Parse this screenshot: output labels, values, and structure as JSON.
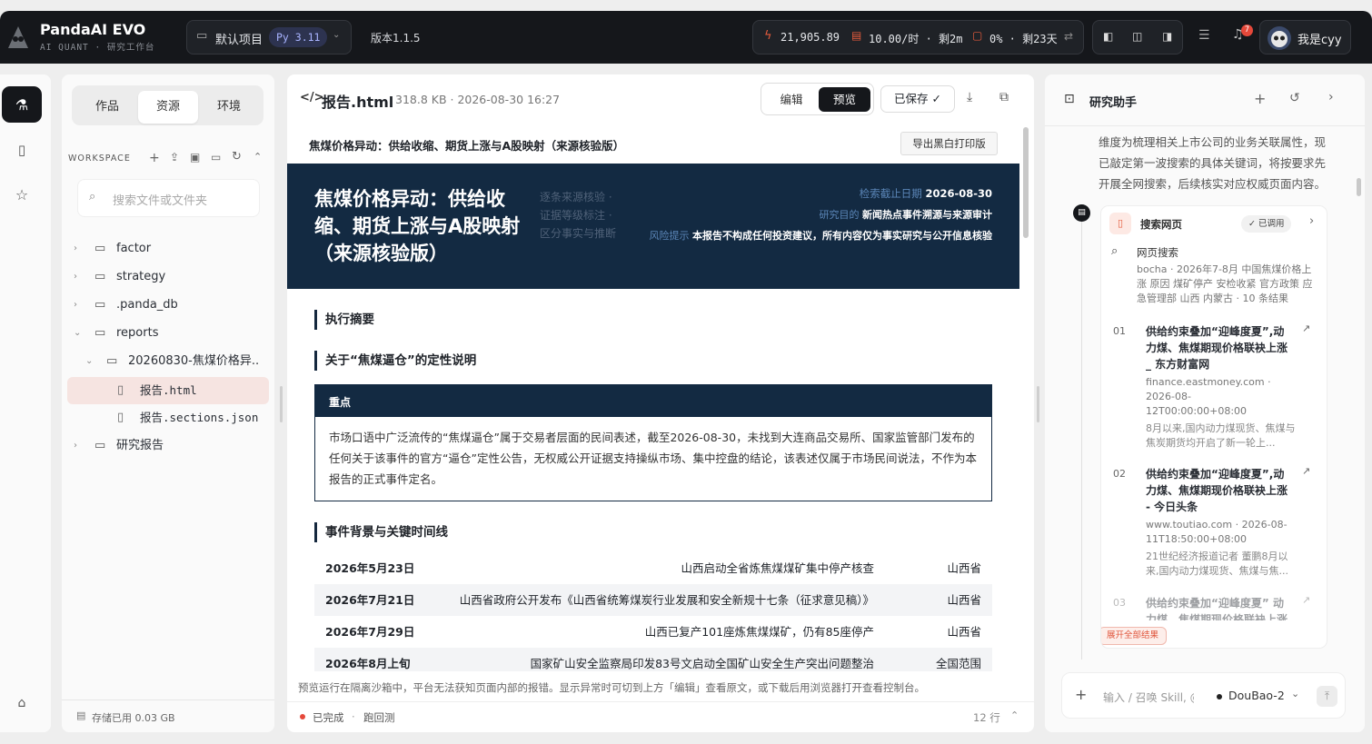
{
  "app": {
    "title": "PandaAI EVO",
    "subtitle": "AI QUANT · 研究工作台"
  },
  "project": {
    "name": "默认项目",
    "python": "Py 3.11"
  },
  "version": "版本1.1.5",
  "stats": {
    "balance": "21,905.89",
    "rate": "10.00/时 · 剩2m",
    "usage": "0% · 剩23天"
  },
  "notifications": {
    "count": "7"
  },
  "user": {
    "name": "我是cyy"
  },
  "left_tabs": [
    "作品",
    "资源",
    "环境"
  ],
  "workspace": {
    "label": "WORKSPACE",
    "search_placeholder": "搜索文件或文件夹"
  },
  "tree": [
    {
      "label": "factor"
    },
    {
      "label": "strategy"
    },
    {
      "label": ".panda_db"
    },
    {
      "label": "reports"
    },
    {
      "label": "20260830-焦煤价格异..."
    },
    {
      "label": "报告.html"
    },
    {
      "label": "报告.sections.json"
    },
    {
      "label": "研究报告"
    }
  ],
  "storage": "存储已用 0.03 GB",
  "file": {
    "name": "报告.html",
    "meta": "318.8 KB · 2026-08-30 16:27"
  },
  "viewer": {
    "edit": "编辑",
    "preview": "预览",
    "saved": "已保存 ✓"
  },
  "doc": {
    "topline": "焦煤价格异动：供给收缩、期货上涨与A股映射（来源核验版）",
    "print_btn": "导出黑白打印版",
    "hero_title": "焦煤价格异动：供给收缩、期货上涨与A股映射（来源核验版）",
    "hero_tags": [
      "逐条来源核验 ·",
      "证据等级标注 ·",
      "区分事实与推断"
    ],
    "hero_meta": [
      {
        "key": "检索截止日期",
        "value": "2026-08-30"
      },
      {
        "key": "研究目的",
        "value": "新闻热点事件溯源与来源审计"
      },
      {
        "key": "风险提示",
        "value": "本报告不构成任何投资建议，所有内容仅为事实研究与公开信息核验"
      }
    ],
    "sec1": "执行摘要",
    "sec2": "关于“焦煤逼仓”的定性说明",
    "callout_title": "重点",
    "callout_text": "市场口语中广泛流传的“焦煤逼仓”属于交易者层面的民间表述，截至2026-08-30，未找到大连商品交易所、国家监管部门发布的任何关于该事件的官方“逼仓”定性公告，无权威公开证据支持操纵市场、集中控盘的结论，该表述仅属于市场民间说法，不作为本报告的正式事件定名。",
    "sec3": "事件背景与关键时间线",
    "timeline": [
      {
        "date": "2026年5月23日",
        "event": "山西启动全省炼焦煤煤矿集中停产核查",
        "region": "山西省"
      },
      {
        "date": "2026年7月21日",
        "event": "山西省政府公开发布《山西省统筹煤炭行业发展和安全新规十七条（征求意见稿）》",
        "region": "山西省"
      },
      {
        "date": "2026年7月29日",
        "event": "山西已复产101座炼焦煤煤矿，仍有85座停产",
        "region": "山西省"
      },
      {
        "date": "2026年8月上旬",
        "event": "国家矿山安全监察局印发83号文启动全国矿山安全生产突出问题整治",
        "region": "全国范围"
      }
    ]
  },
  "notice": "预览运行在隔离沙箱中，平台无法获知页面内部的报错。显示异常时可切到上方「编辑」查看原文，或下载后用浏览器打开查看控制台。",
  "status": {
    "done": "已完成",
    "sep": "·",
    "backtest": "跑回测",
    "lines": "12 行"
  },
  "assistant": {
    "title": "研究助手",
    "intro": "维度为梳理相关上市公司的业务关联属性，现已敲定第一波搜索的具体关键词，将按要求先开展全网搜索，后续核实对应权威页面内容。",
    "tool_name": "搜索网页",
    "tool_status": "✓ 已调用",
    "search_label": "网页搜索",
    "search_query": "bocha · 2026年7-8月 中国焦煤价格上涨 原因 煤矿停产 安检收紧 官方政策 应急管理部 山西 内蒙古 · 10 条结果",
    "results": [
      {
        "num": "01",
        "title": "供给约束叠加“迎峰度夏”,动力煤、焦煤期现价格联袂上涨 _ 东方财富网",
        "meta": "finance.eastmoney.com · 2026-08-12T00:00:00+08:00",
        "snippet": "8月以来,国内动力煤现货、焦煤与焦炭期货均开启了新一轮上..."
      },
      {
        "num": "02",
        "title": "供给约束叠加“迎峰度夏”,动力煤、焦煤期现价格联袂上涨 - 今日头条",
        "meta": "www.toutiao.com · 2026-08-11T18:50:00+08:00",
        "snippet": "21世纪经济报道记者 董鹏8月以来,国内动力煤现货、焦煤与焦..."
      },
      {
        "num": "03",
        "title": "供给约束叠加“迎峰度夏” 动力煤、焦煤期现价格联袂上涨",
        "meta": "",
        "snippet": ""
      }
    ],
    "expand": "展开全部结果",
    "input_placeholder": "输入 / 召唤 Skill, @",
    "model": "DouBao-2"
  }
}
